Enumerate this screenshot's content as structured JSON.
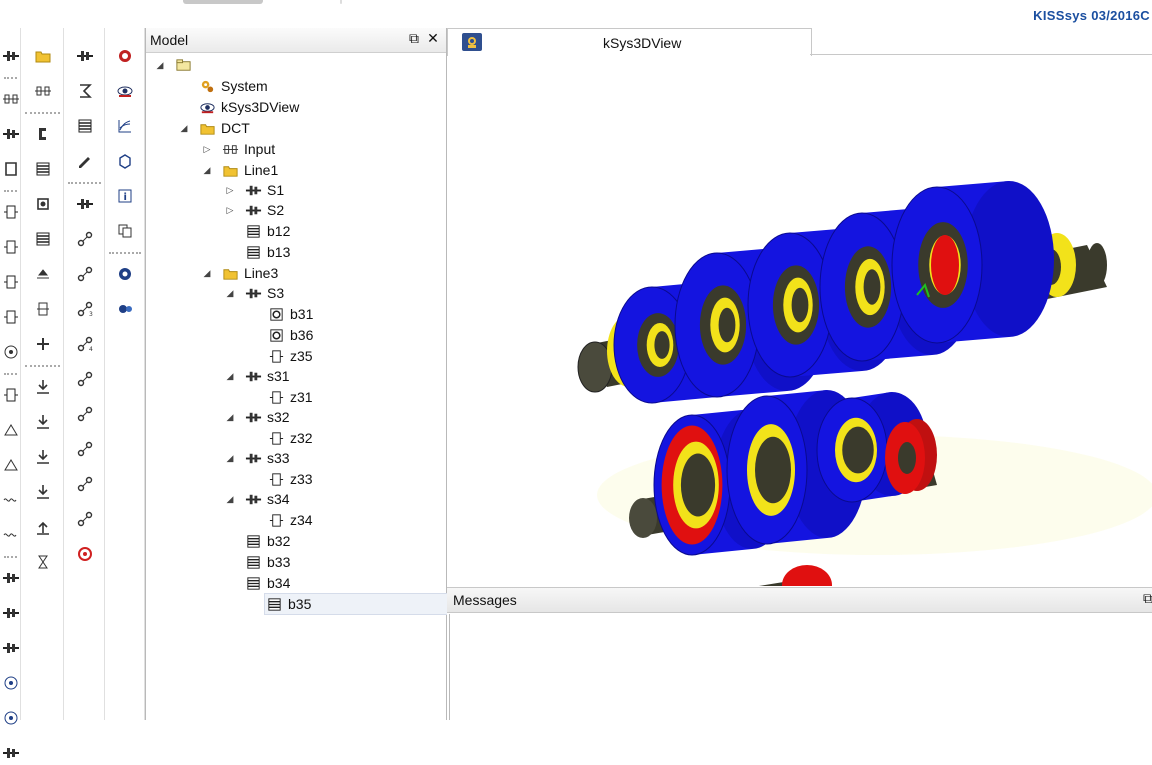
{
  "app": {
    "brand": "KISSsys 03/2016C"
  },
  "model_panel": {
    "title": "Model",
    "tree": [
      {
        "label": "",
        "icon": "folder-root-icon",
        "expander": "expanded",
        "depth": 0
      },
      {
        "label": "System",
        "icon": "system-gear-icon",
        "expander": "none",
        "depth": 1
      },
      {
        "label": "kSys3DView",
        "icon": "3d-view-eye-icon",
        "expander": "none",
        "depth": 1
      },
      {
        "label": "DCT",
        "icon": "folder-icon",
        "expander": "expanded",
        "depth": 1
      },
      {
        "label": "Input",
        "icon": "coupling-icon",
        "expander": "collapsed",
        "depth": 2
      },
      {
        "label": "Line1",
        "icon": "folder-icon",
        "expander": "expanded",
        "depth": 2
      },
      {
        "label": "S1",
        "icon": "shaft-icon",
        "expander": "collapsed",
        "depth": 3
      },
      {
        "label": "S2",
        "icon": "shaft-icon",
        "expander": "collapsed",
        "depth": 3
      },
      {
        "label": "b12",
        "icon": "bearing-icon",
        "expander": "none",
        "depth": 3
      },
      {
        "label": "b13",
        "icon": "bearing-icon",
        "expander": "none",
        "depth": 3
      },
      {
        "label": "Line3",
        "icon": "folder-icon",
        "expander": "expanded",
        "depth": 2
      },
      {
        "label": "S3",
        "icon": "shaft-icon",
        "expander": "expanded",
        "depth": 3
      },
      {
        "label": "b31",
        "icon": "rolling-bearing-icon",
        "expander": "none",
        "depth": 4
      },
      {
        "label": "b36",
        "icon": "rolling-bearing-icon",
        "expander": "none",
        "depth": 4
      },
      {
        "label": "z35",
        "icon": "gear-icon",
        "expander": "none",
        "depth": 4
      },
      {
        "label": "s31",
        "icon": "shaft-icon",
        "expander": "expanded",
        "depth": 3
      },
      {
        "label": "z31",
        "icon": "gear-icon",
        "expander": "none",
        "depth": 4
      },
      {
        "label": "s32",
        "icon": "shaft-icon",
        "expander": "expanded",
        "depth": 3
      },
      {
        "label": "z32",
        "icon": "gear-icon",
        "expander": "none",
        "depth": 4
      },
      {
        "label": "s33",
        "icon": "shaft-icon",
        "expander": "expanded",
        "depth": 3
      },
      {
        "label": "z33",
        "icon": "gear-icon",
        "expander": "none",
        "depth": 4
      },
      {
        "label": "s34",
        "icon": "shaft-icon",
        "expander": "expanded",
        "depth": 3
      },
      {
        "label": "z34",
        "icon": "gear-icon",
        "expander": "none",
        "depth": 4
      },
      {
        "label": "b32",
        "icon": "bearing-icon",
        "expander": "none",
        "depth": 3
      },
      {
        "label": "b33",
        "icon": "bearing-icon",
        "expander": "none",
        "depth": 3
      },
      {
        "label": "b34",
        "icon": "bearing-icon",
        "expander": "none",
        "depth": 3
      },
      {
        "label": "b35",
        "icon": "bearing-icon",
        "expander": "none",
        "depth": 3,
        "selected": true
      }
    ]
  },
  "view_panel": {
    "tab_label": "kSys3DView",
    "tab_icon": "3d-view-icon",
    "colors": {
      "gear_blue": "#1414e0",
      "ring_yellow": "#f2e21a",
      "ring_red": "#e01010",
      "shaft_dark": "#3a3a2c"
    }
  },
  "messages_panel": {
    "title": "Messages"
  },
  "toolbar": {
    "col1": [
      "shaft-icon",
      "coupling-icon",
      "shaft-icon",
      "housing-icon",
      "gear-icon",
      "gear-icon",
      "gear-icon",
      "gear-icon",
      "planet-icon",
      "gear-icon",
      "bevel-gear-icon",
      "bevel-gear-icon",
      "worm-icon",
      "worm-icon",
      "shaft-icon",
      "shaft-icon",
      "shaft-icon",
      "target-icon",
      "target-icon",
      "shaft-icon"
    ],
    "col2": [
      "folder-icon",
      "coupling-icon",
      "clamp-icon",
      "bearing-icon",
      "mount-icon",
      "bearing-icon",
      "shift-icon",
      "plate-icon",
      "switch-icon",
      "load-down-icon",
      "load-down-icon",
      "load-down-icon",
      "load-down-icon",
      "load-up-icon",
      "hourglass-icon"
    ],
    "col3": [
      "shaft-icon",
      "sum-icon",
      "bearing-icon",
      "edit-icon",
      "shaft-icon",
      "connection-icon",
      "connection-icon",
      "connection-3-icon",
      "connection-4-icon",
      "connection-icon",
      "connection-icon",
      "connection-icon",
      "connection-icon",
      "connection-icon",
      "stop-icon"
    ],
    "col4": [
      "kisssoft-icon",
      "eye-icon",
      "diagram-icon",
      "cube-icon",
      "info-icon",
      "copy-icon",
      "gear-target-icon",
      "planet-gear-icon"
    ]
  }
}
